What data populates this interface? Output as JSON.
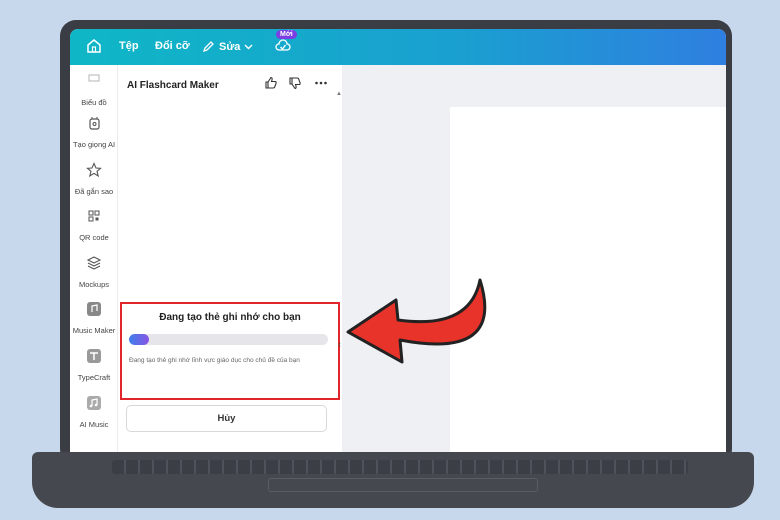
{
  "topbar": {
    "file_label": "Tệp",
    "resize_label": "Đổi cỡ",
    "edit_label": "Sửa",
    "new_badge": "Mới"
  },
  "rail": {
    "items": [
      {
        "label": "Biểu đồ",
        "icon": "chart-icon"
      },
      {
        "label": "Tạo giọng AI",
        "icon": "voice-icon"
      },
      {
        "label": "Đã gắn sao",
        "icon": "star-icon"
      },
      {
        "label": "QR code",
        "icon": "qr-code-icon"
      },
      {
        "label": "Mockups",
        "icon": "layers-icon"
      },
      {
        "label": "Music Maker",
        "icon": "music-maker-icon"
      },
      {
        "label": "TypeCraft",
        "icon": "typecraft-icon"
      },
      {
        "label": "AI Music",
        "icon": "music-note-icon"
      }
    ]
  },
  "panel": {
    "title": "AI Flashcard Maker",
    "progress_title": "Đang tạo thẻ ghi nhớ cho bạn",
    "progress_fraction": 0.1,
    "progress_desc": "Đang tạo thẻ ghi nhớ lĩnh vực giáo dục cho chủ đề của bạn",
    "cancel_label": "Hủy"
  },
  "colors": {
    "highlight_border": "#e0262a",
    "arrow": "#e8332a",
    "topbar_start": "#0fb7c6",
    "topbar_end": "#2f7fe0"
  }
}
